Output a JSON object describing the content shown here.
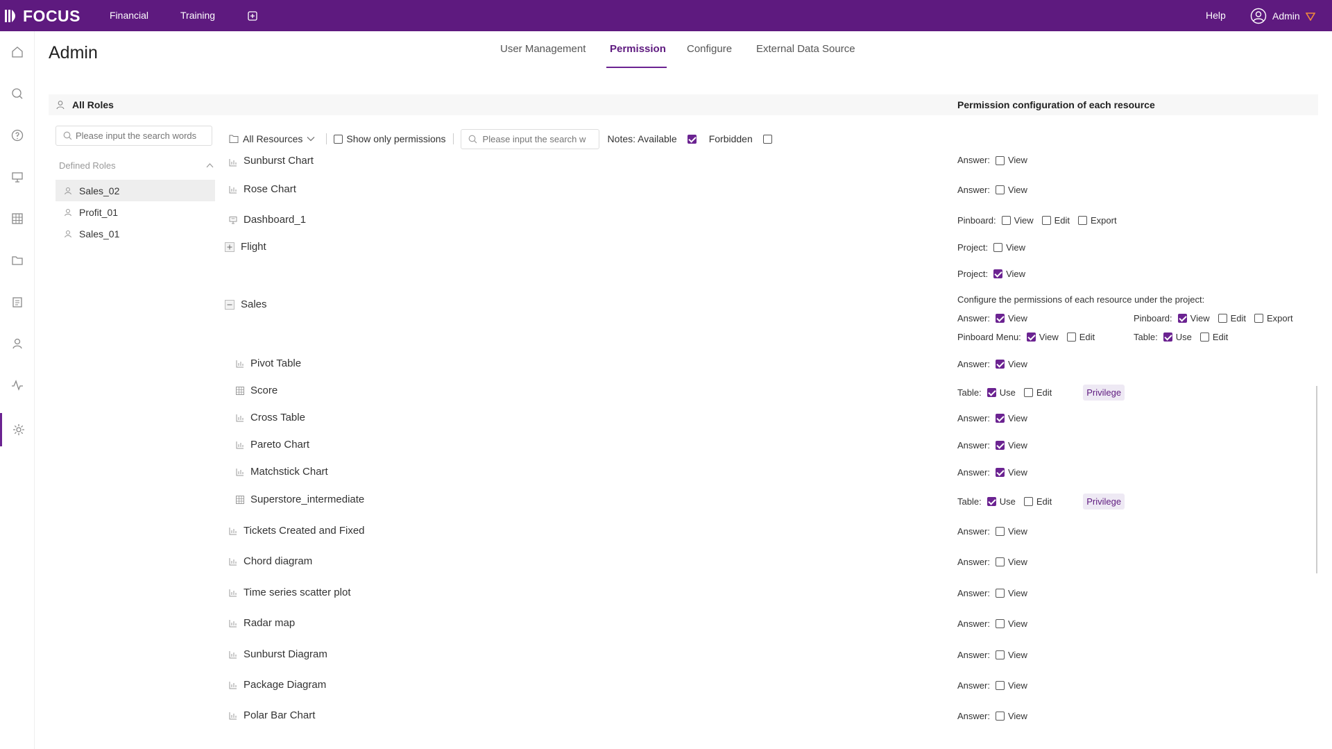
{
  "brand": "FOCUS",
  "nav": {
    "financial": "Financial",
    "training": "Training",
    "help": "Help",
    "user": "Admin"
  },
  "page": {
    "title": "Admin",
    "tabs": [
      "User Management",
      "Permission",
      "Configure",
      "External Data Source"
    ]
  },
  "roles": {
    "header": "All Roles",
    "search_placeholder": "Please input the search words",
    "defined_label": "Defined Roles",
    "items": [
      "Sales_02",
      "Profit_01",
      "Sales_01"
    ]
  },
  "resources": {
    "header": "Permission configuration of each resource",
    "filter": "All Resources",
    "show_only": "Show only permissions",
    "search_placeholder": "Please input the search w",
    "notes_available": "Notes: Available",
    "notes_forbidden": "Forbidden"
  },
  "items": {
    "sunburst_chart": "Sunburst Chart",
    "rose_chart": "Rose Chart",
    "dashboard_1": "Dashboard_1",
    "flight": "Flight",
    "sales": "Sales",
    "pivot_table": "Pivot Table",
    "score": "Score",
    "cross_table": "Cross Table",
    "pareto_chart": "Pareto Chart",
    "matchstick_chart": "Matchstick Chart",
    "superstore": "Superstore_intermediate",
    "tickets": "Tickets Created and Fixed",
    "chord": "Chord diagram",
    "time_series": "Time series scatter plot",
    "radar": "Radar map",
    "sunburst_diagram": "Sunburst Diagram",
    "package": "Package Diagram",
    "polar": "Polar Bar Chart"
  },
  "labels": {
    "answer": "Answer:",
    "pinboard": "Pinboard:",
    "project": "Project:",
    "table": "Table:",
    "pinboard_menu": "Pinboard Menu:",
    "view": "View",
    "edit": "Edit",
    "export": "Export",
    "use": "Use",
    "privilege": "Privilege",
    "configure_note": "Configure the permissions of each resource under the project:"
  }
}
